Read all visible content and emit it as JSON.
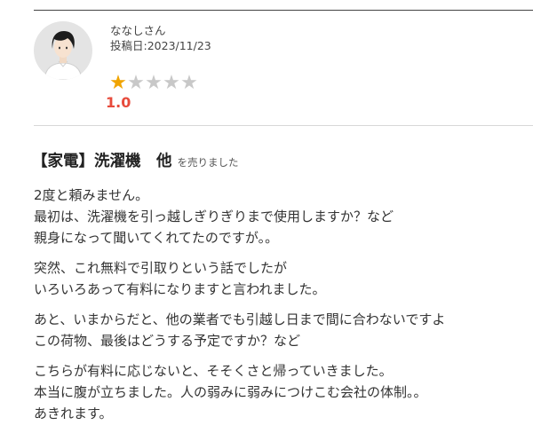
{
  "review": {
    "author": "ななしさん",
    "posted": "投稿日:2023/11/23",
    "rating": 1,
    "max_rating": 5,
    "score": "1.0",
    "star_colors": {
      "filled": "#f0a400",
      "empty": "#c8c8c8"
    },
    "score_color": "#e74b3c",
    "title": "【家電】洗濯機　他",
    "title_suffix": "を売りました",
    "paragraphs": [
      [
        "2度と頼みません。",
        "最初は、洗濯機を引っ越しぎりぎりまで使用しますか？など",
        "親身になって聞いてくれてたのですが。。"
      ],
      [
        "突然、これ無料で引取りという話でしたが",
        "いろいろあって有料になりますと言われました。"
      ],
      [
        "あと、いまからだと、他の業者でも引越し日まで間に合わないですよ",
        "この荷物、最後はどうする予定ですか？など"
      ],
      [
        "こちらが有料に応じないと、そそくさと帰っていきました。",
        "本当に腹が立ちました。人の弱みに弱みにつけこむ会社の体制。。",
        "あきれます。"
      ]
    ]
  }
}
